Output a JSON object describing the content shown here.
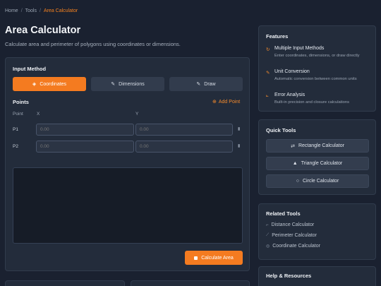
{
  "breadcrumb": {
    "items": [
      "Home",
      "Tools"
    ],
    "separator": "/",
    "current": "Area Calculator"
  },
  "page": {
    "title": "Area Calculator",
    "subtitle": "Calculate area and perimeter of polygons using coordinates or dimensions."
  },
  "input_method": {
    "title": "Input Method",
    "methods": [
      {
        "label": "Coordinates",
        "icon": "crosshair-icon",
        "active": true
      },
      {
        "label": "Dimensions",
        "icon": "ruler-icon",
        "active": false
      },
      {
        "label": "Draw",
        "icon": "pencil-icon",
        "active": false
      }
    ]
  },
  "points": {
    "title": "Points",
    "add_label": "Add Point",
    "columns": [
      "Point",
      "X",
      "Y"
    ],
    "rows": [
      {
        "label": "P1",
        "x_placeholder": "0.00",
        "y_placeholder": "0.00"
      },
      {
        "label": "P2",
        "x_placeholder": "0.00",
        "y_placeholder": "0.00"
      }
    ]
  },
  "actions": {
    "calculate_label": "Calculate Area"
  },
  "features": {
    "title": "Features",
    "items": [
      {
        "title": "Multiple Input Methods",
        "desc": "Enter coordinates, dimensions, or draw directly",
        "icon": "refresh-icon"
      },
      {
        "title": "Unit Conversion",
        "desc": "Automatic conversion between common units",
        "icon": "pencil-icon"
      },
      {
        "title": "Error Analysis",
        "desc": "Built-in precision and closure calculations",
        "icon": "chart-icon"
      }
    ]
  },
  "quick_tools": {
    "title": "Quick Tools",
    "items": [
      {
        "label": "Rectangle Calculator",
        "icon": "swap-icon"
      },
      {
        "label": "Triangle Calculator",
        "icon": "triangle-icon"
      },
      {
        "label": "Circle Calculator",
        "icon": "circle-icon"
      }
    ]
  },
  "related_tools": {
    "title": "Related Tools",
    "items": [
      {
        "label": "Distance Calculator",
        "icon": "distance-icon"
      },
      {
        "label": "Perimeter Calculator",
        "icon": "perimeter-icon"
      },
      {
        "label": "Coordinate Calculator",
        "icon": "target-icon"
      }
    ]
  },
  "help": {
    "title": "Help & Resources"
  },
  "colors": {
    "accent": "#f47b20",
    "background": "#1a2130",
    "card": "#232c3b"
  }
}
